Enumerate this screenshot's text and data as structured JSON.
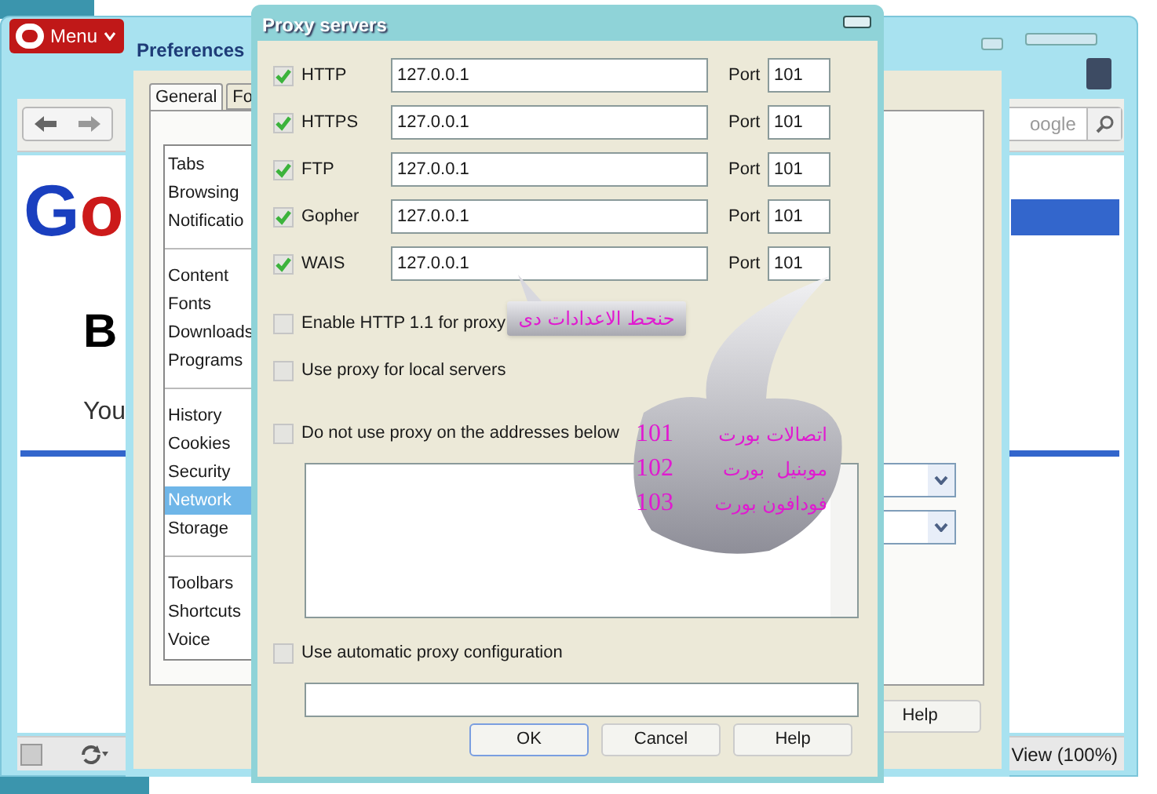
{
  "browser": {
    "menu_button": "Menu",
    "search_placeholder": "oogle",
    "logo": [
      {
        "text": "G",
        "color": "#1a3fbf"
      },
      {
        "text": "o",
        "color": "#cc1a1a"
      }
    ],
    "heading": "B",
    "text": "You",
    "status": "View (100%)"
  },
  "preferences": {
    "title": "Preferences",
    "tabs": [
      {
        "label": "General",
        "selected": true
      },
      {
        "label": "Fo",
        "selected": false
      }
    ],
    "groups": [
      {
        "items": [
          {
            "label": "Tabs",
            "selected": false
          },
          {
            "label": "Browsing",
            "selected": false
          },
          {
            "label": "Notificatio",
            "selected": false
          }
        ]
      },
      {
        "items": [
          {
            "label": "Content",
            "selected": false
          },
          {
            "label": "Fonts",
            "selected": false
          },
          {
            "label": "Downloads",
            "selected": false
          },
          {
            "label": "Programs",
            "selected": false
          }
        ]
      },
      {
        "items": [
          {
            "label": "History",
            "selected": false
          },
          {
            "label": "Cookies",
            "selected": false
          },
          {
            "label": "Security",
            "selected": false
          },
          {
            "label": "Network",
            "selected": true
          },
          {
            "label": "Storage",
            "selected": false
          }
        ]
      },
      {
        "items": [
          {
            "label": "Toolbars",
            "selected": false
          },
          {
            "label": "Shortcuts",
            "selected": false
          },
          {
            "label": "Voice",
            "selected": false
          }
        ]
      }
    ],
    "help_button": "Help"
  },
  "proxy_dialog": {
    "title": "Proxy servers",
    "servers": [
      {
        "protocol": "HTTP",
        "checked": true,
        "address": "127.0.0.1",
        "port_label": "Port",
        "port": "101"
      },
      {
        "protocol": "HTTPS",
        "checked": true,
        "address": "127.0.0.1",
        "port_label": "Port",
        "port": "101"
      },
      {
        "protocol": "FTP",
        "checked": true,
        "address": "127.0.0.1",
        "port_label": "Port",
        "port": "101"
      },
      {
        "protocol": "Gopher",
        "checked": true,
        "address": "127.0.0.1",
        "port_label": "Port",
        "port": "101"
      },
      {
        "protocol": "WAIS",
        "checked": true,
        "address": "127.0.0.1",
        "port_label": "Port",
        "port": "101"
      }
    ],
    "options": [
      {
        "label": "Enable HTTP 1.1 for proxy",
        "checked": false
      },
      {
        "label": "Use proxy for local servers",
        "checked": false
      }
    ],
    "exceptions": {
      "label": "Do not use proxy on the addresses below",
      "checked": false
    },
    "auto_config": {
      "label": "Use automatic proxy configuration",
      "checked": false
    },
    "buttons": [
      "OK",
      "Cancel",
      "Help"
    ]
  },
  "annotations": {
    "note": "حنحط الاعدادات دى",
    "ports": [
      {
        "name": "اتصالات بورت",
        "port": "101"
      },
      {
        "name": "موبنيل  بورت",
        "port": "102"
      },
      {
        "name": "فودافون بورت",
        "port": "103"
      }
    ]
  }
}
